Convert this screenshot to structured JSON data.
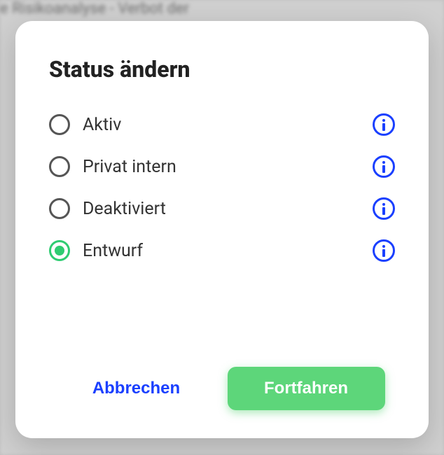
{
  "modal": {
    "title": "Status ändern",
    "options": [
      {
        "label": "Aktiv",
        "selected": false
      },
      {
        "label": "Privat intern",
        "selected": false
      },
      {
        "label": "Deaktiviert",
        "selected": false
      },
      {
        "label": "Entwurf",
        "selected": true
      }
    ],
    "cancel_label": "Abbrechen",
    "confirm_label": "Fortfahren"
  },
  "backdrop": {
    "text_fragment": "e Risikoanalyse - Verbot der"
  }
}
